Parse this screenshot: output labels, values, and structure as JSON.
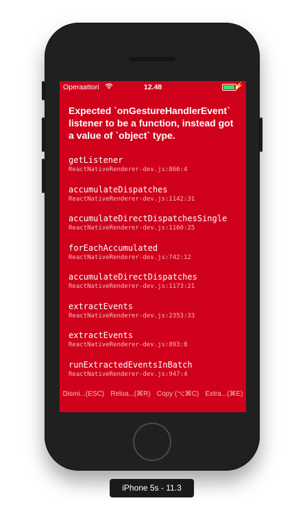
{
  "status_bar": {
    "carrier": "Operaattori",
    "wifi_icon": "wifi-icon",
    "time": "12.48",
    "battery_icon": "battery-icon",
    "charging_icon": "⚡"
  },
  "redbox": {
    "background": "#d0021b",
    "message": "Expected `onGestureHandlerEvent` listener to be a function, instead got a value of `object` type.",
    "stack": [
      {
        "method": "getListener",
        "file": "ReactNativeRenderer-dev.js:866:4"
      },
      {
        "method": "accumulateDispatches",
        "file": "ReactNativeRenderer-dev.js:1142:31"
      },
      {
        "method": "accumulateDirectDispatchesSingle",
        "file": "ReactNativeRenderer-dev.js:1160:25"
      },
      {
        "method": "forEachAccumulated",
        "file": "ReactNativeRenderer-dev.js:742:12"
      },
      {
        "method": "accumulateDirectDispatches",
        "file": "ReactNativeRenderer-dev.js:1173:21"
      },
      {
        "method": "extractEvents",
        "file": "ReactNativeRenderer-dev.js:2353:33"
      },
      {
        "method": "extractEvents",
        "file": "ReactNativeRenderer-dev.js:893:8"
      },
      {
        "method": "runExtractedEventsInBatch",
        "file": "ReactNativeRenderer-dev.js:947:4"
      }
    ],
    "buttons": {
      "dismiss": "Dismi...(ESC)",
      "reload": "Reloa...(⌘R)",
      "copy": "Copy (⌥⌘C)",
      "extra": "Extra...(⌘E)"
    }
  },
  "simulator": {
    "device_label": "iPhone 5s - 11.3"
  }
}
